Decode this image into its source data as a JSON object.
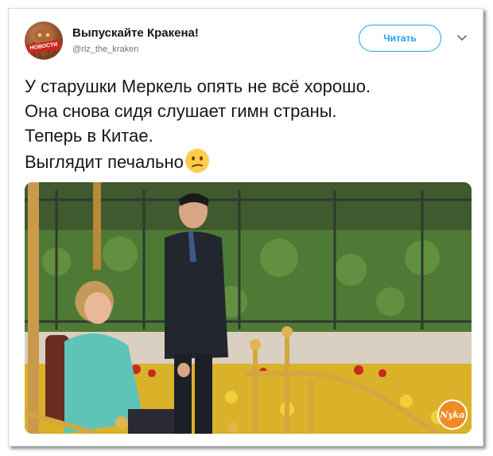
{
  "tweet": {
    "author_name": "Выпускайте Кракена!",
    "handle": "@rlz_the_kraken",
    "avatar_badge": "НОВОСТИ",
    "follow_label": "Читать",
    "text_lines": [
      "У старушки Меркель опять не всё хорошо.",
      "Она снова сидя слушает гимн страны.",
      "Теперь в Китае.",
      "Выглядит печально"
    ],
    "emoji": "confused-face-emoji"
  },
  "watermark": {
    "text": "Nyka"
  },
  "colors": {
    "accent": "#1da1f2",
    "text": "#14171a",
    "muted": "#657786",
    "watermark": "#f08a24"
  }
}
